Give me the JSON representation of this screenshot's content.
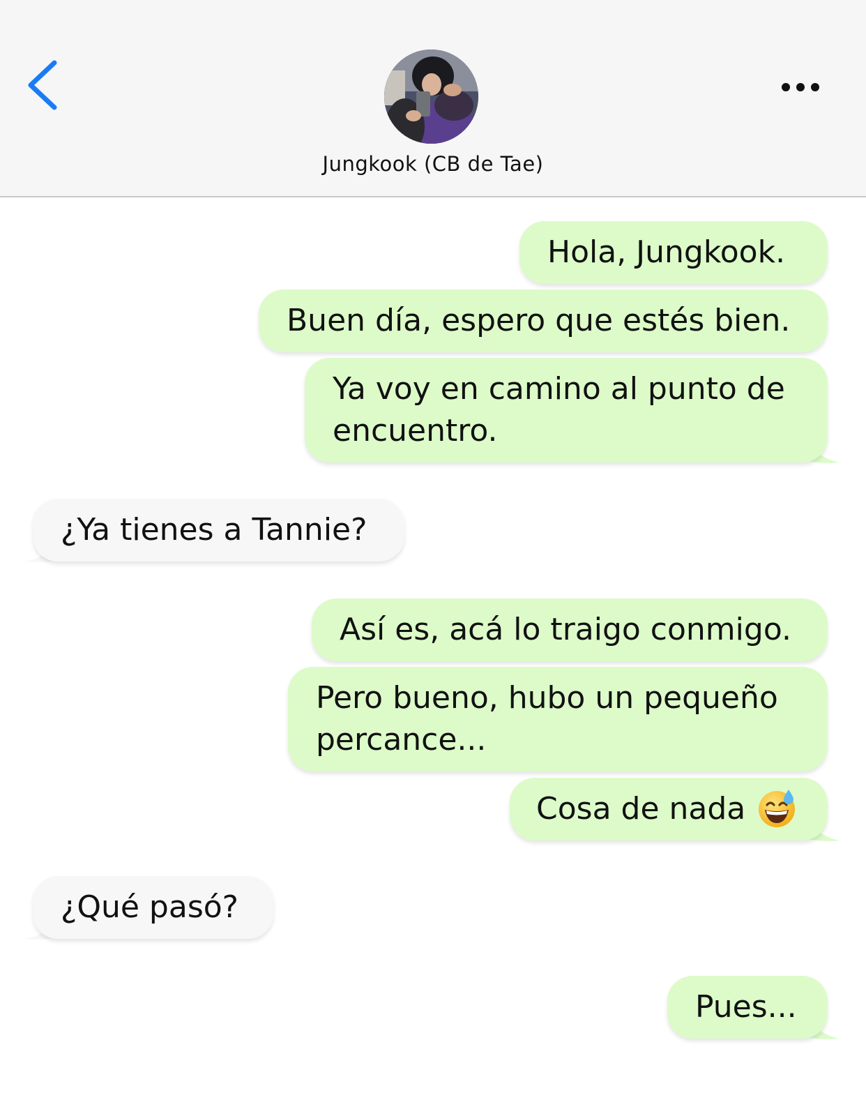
{
  "app": {
    "accent_color": "#1a7cf5",
    "outgoing_bubble_color": "#dcfbc9",
    "incoming_bubble_color": "#f7f7f7"
  },
  "header": {
    "back_icon": "chevron-left-icon",
    "more_icon": "ellipsis-icon",
    "contact_name": "Jungkook (CB de Tae)"
  },
  "messages": [
    {
      "direction": "outgoing",
      "text": "Hola, Jungkook."
    },
    {
      "direction": "outgoing",
      "text": "Buen día, espero que estés bien."
    },
    {
      "direction": "outgoing",
      "lines": [
        "Ya voy en camino al punto de",
        "encuentro."
      ]
    },
    {
      "direction": "incoming",
      "text": "¿Ya tienes a Tannie?"
    },
    {
      "direction": "outgoing",
      "text": "Así es, acá lo traigo conmigo."
    },
    {
      "direction": "outgoing",
      "lines": [
        "Pero bueno, hubo un pequeño",
        "percance..."
      ]
    },
    {
      "direction": "outgoing",
      "text": "Cosa de nada",
      "emoji": "grinning-sweat-emoji"
    },
    {
      "direction": "incoming",
      "text": "¿Qué pasó?"
    },
    {
      "direction": "outgoing",
      "text": "Pues..."
    }
  ]
}
